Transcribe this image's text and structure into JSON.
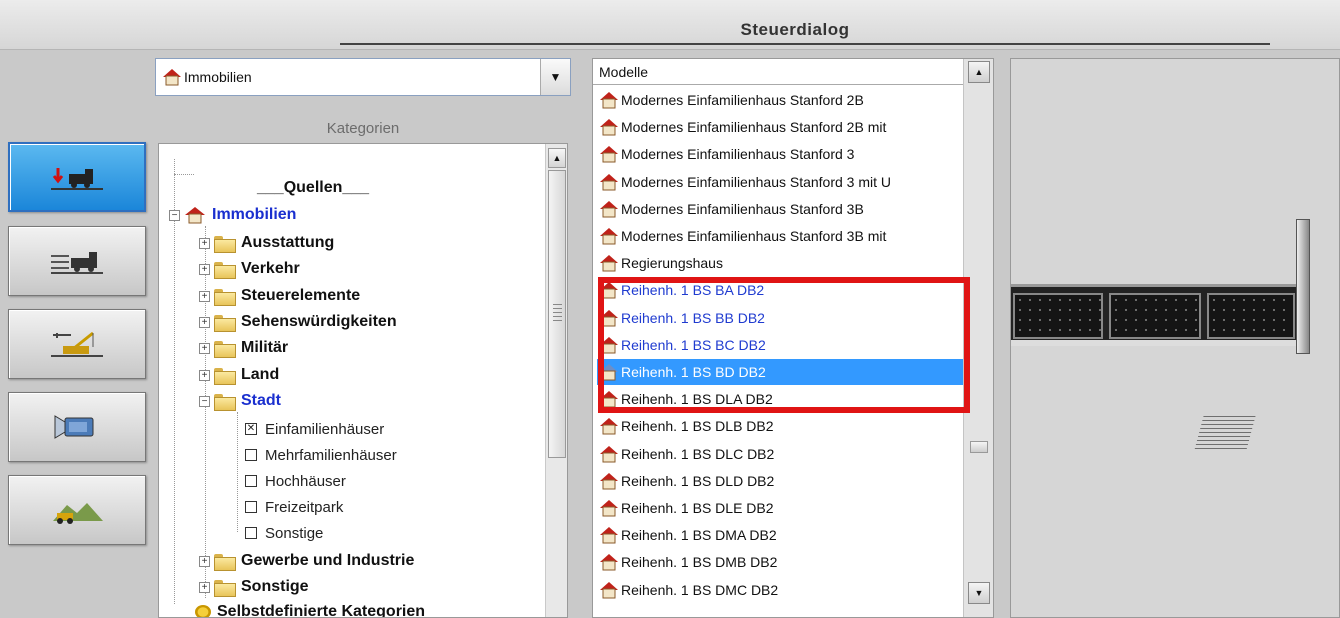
{
  "window": {
    "title": "Steuerdialog"
  },
  "left_buttons": [
    {
      "name": "objects-load-button",
      "icon": "track-plan-train-icon",
      "active": true
    },
    {
      "name": "track-layout-button",
      "icon": "train-tracks-icon",
      "active": false
    },
    {
      "name": "construction-button",
      "icon": "crane-icon",
      "active": false
    },
    {
      "name": "camera-button",
      "icon": "video-camera-icon",
      "active": false
    },
    {
      "name": "landscape-button",
      "icon": "landscape-vehicle-icon",
      "active": false
    }
  ],
  "category_select": {
    "value": "Immobilien",
    "icon": "house-icon"
  },
  "kategorien_label": "Kategorien",
  "tree": {
    "quellen": "___Quellen___",
    "immobilien": "Immobilien",
    "folders": [
      {
        "label": "Ausstattung"
      },
      {
        "label": "Verkehr"
      },
      {
        "label": "Steuerelemente"
      },
      {
        "label": "Sehenswürdigkeiten"
      },
      {
        "label": "Militär"
      },
      {
        "label": "Land"
      }
    ],
    "stadt": "Stadt",
    "stadt_children": [
      {
        "label": "Einfamilienhäuser",
        "checked": true
      },
      {
        "label": "Mehrfamilienhäuser",
        "checked": false
      },
      {
        "label": "Hochhäuser",
        "checked": false
      },
      {
        "label": "Freizeitpark",
        "checked": false
      },
      {
        "label": "Sonstige",
        "checked": false
      }
    ],
    "after_folders": [
      {
        "label": "Gewerbe und Industrie"
      },
      {
        "label": "Sonstige"
      }
    ],
    "selbst": "Selbstdefinierte Kategorien"
  },
  "models": {
    "header": "Modelle",
    "items": [
      {
        "label": "Modernes Einfamilienhaus Stanford 2B",
        "style": "normal"
      },
      {
        "label": "Modernes Einfamilienhaus Stanford 2B mit",
        "style": "normal"
      },
      {
        "label": "Modernes Einfamilienhaus Stanford 3",
        "style": "normal"
      },
      {
        "label": "Modernes Einfamilienhaus Stanford 3 mit U",
        "style": "normal"
      },
      {
        "label": "Modernes Einfamilienhaus Stanford 3B",
        "style": "normal"
      },
      {
        "label": "Modernes Einfamilienhaus Stanford 3B mit",
        "style": "normal"
      },
      {
        "label": "Regierungshaus",
        "style": "normal"
      },
      {
        "label": "Reihenh. 1 BS BA DB2",
        "style": "blue"
      },
      {
        "label": "Reihenh. 1 BS BB DB2",
        "style": "blue"
      },
      {
        "label": "Reihenh. 1 BS BC DB2",
        "style": "blue"
      },
      {
        "label": "Reihenh. 1 BS BD DB2",
        "style": "selected"
      },
      {
        "label": "Reihenh. 1 BS DLA DB2",
        "style": "normal"
      },
      {
        "label": "Reihenh. 1 BS DLB DB2",
        "style": "normal"
      },
      {
        "label": "Reihenh. 1 BS DLC DB2",
        "style": "normal"
      },
      {
        "label": "Reihenh. 1 BS DLD DB2",
        "style": "normal"
      },
      {
        "label": "Reihenh. 1 BS DLE DB2",
        "style": "normal"
      },
      {
        "label": "Reihenh. 1 BS DMA DB2",
        "style": "normal"
      },
      {
        "label": "Reihenh. 1 BS DMB DB2",
        "style": "normal"
      },
      {
        "label": "Reihenh. 1 BS DMC DB2",
        "style": "normal"
      }
    ]
  },
  "colors": {
    "accent_blue": "#3399ff",
    "highlight_red": "#e01414",
    "link_blue": "#1f3bd0",
    "tree_blue": "#1a2fcf"
  }
}
